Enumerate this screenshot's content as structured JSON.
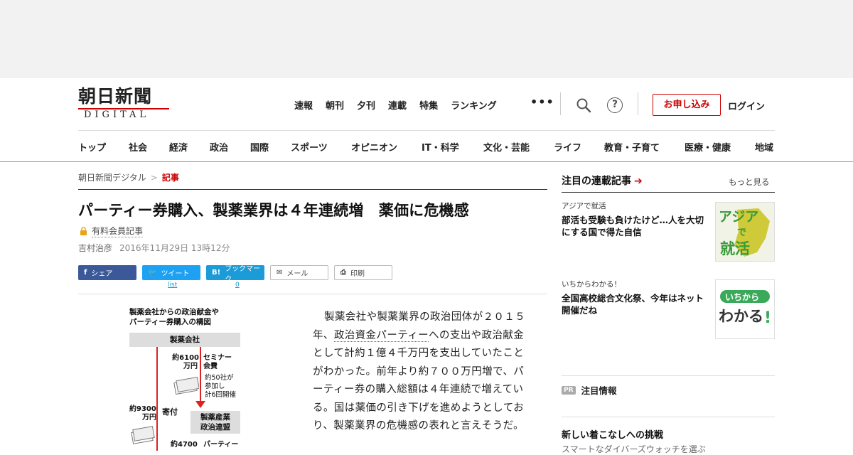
{
  "header": {
    "logo_kanji": "朝日新聞",
    "logo_sub": "DIGITAL",
    "topnav": [
      "速報",
      "朝刊",
      "夕刊",
      "連載",
      "特集",
      "ランキング"
    ],
    "apply": "お申し込み",
    "login": "ログイン",
    "help": "?",
    "categories": [
      "トップ",
      "社会",
      "経済",
      "政治",
      "国際",
      "スポーツ",
      "オピニオン",
      "IT・科学",
      "文化・芸能",
      "ライフ",
      "教育・子育て",
      "医療・健康",
      "地域"
    ]
  },
  "breadcrumb": {
    "home": "朝日新聞デジタル",
    "current": "記事"
  },
  "article": {
    "headline": "パーティー券購入、製薬業界は４年連続増　薬価に危機感",
    "paid_label": "有料会員記事",
    "author": "吉村治彦",
    "date": "2016年11月29日 13時12分",
    "body_before_link": "製薬会社や製薬業界の政治団体が２０１５年、",
    "body_link": "政治資金パーティー",
    "body_after_link": "への支出や政治献金として計約１億４千万円を支出していたことがわかった。前年より約７００万円増で、パーティー券の購入総額は４年連続で増えている。国は薬価の引き下げを進めようとしており、製薬業界の危機感の表れと言えそうだ。"
  },
  "share": {
    "facebook": "シェア",
    "twitter": "ツイート",
    "twitter_count": "list",
    "hatena": "ブックマーク",
    "hatena_count": "0",
    "mail": "メール",
    "print": "印刷"
  },
  "graphic": {
    "title_line1": "製薬会社からの政治献金や",
    "title_line2": "パーティー券購入の構図",
    "box_company": "製薬会社",
    "amount1": "約6100",
    "unit1": "万円",
    "seminar1": "セミナー",
    "seminar2": "会費",
    "note1": "約50社が",
    "note2": "参加し",
    "note3": "計6回開催",
    "amount2": "約9300",
    "unit2": "万円",
    "donation": "寄付",
    "box_league1": "製薬産業",
    "box_league2": "政治連盟",
    "amount3": "約4700",
    "party": "パーティー"
  },
  "sidebar": {
    "heading": "注目の連載記事",
    "more": "もっと見る",
    "items": [
      {
        "tag": "アジアで就活",
        "title": "部活も受験も負けたけど…人を大切にする国で得た自信",
        "thumb_line1": "アジア",
        "thumb_line2": "で",
        "thumb_line3": "就活"
      },
      {
        "tag": "いちからわかる！",
        "title": "全国高校総合文化祭、今年はネット開催だね",
        "thumb_line1": "いちから",
        "thumb_line2": "わかる",
        "thumb_line3": "!"
      }
    ],
    "pr_badge": "PR",
    "pr_label": "注目情報",
    "bottom_title": "新しい着こなしへの挑戦",
    "bottom_sub": "スマートなダイバーズウォッチを選ぶ"
  },
  "colors": {
    "brand_red": "#cc0000",
    "facebook": "#3b5998",
    "twitter": "#1da1f2",
    "hatena": "#1b9bd8"
  }
}
